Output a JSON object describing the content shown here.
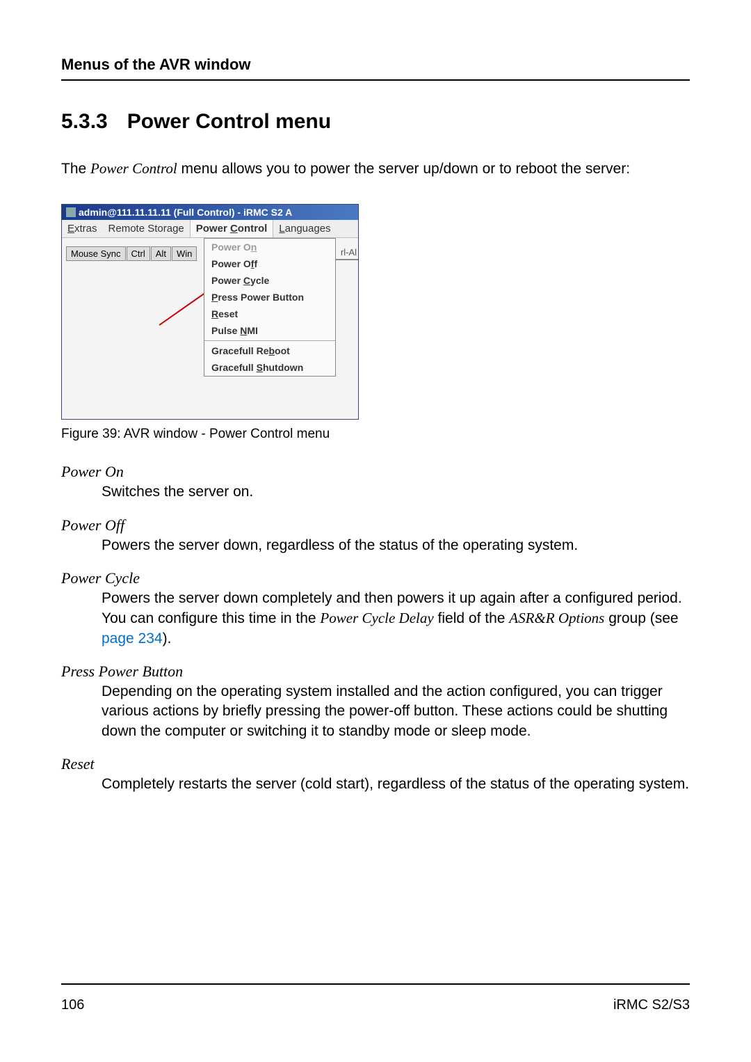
{
  "header": {
    "title": "Menus of the AVR window"
  },
  "section": {
    "num": "5.3.3",
    "title": "Power Control menu"
  },
  "intro": {
    "pre": "The ",
    "em": "Power Control",
    "post": " menu allows you to power the server up/down or to reboot the server:"
  },
  "avr": {
    "titlebar": "admin@111.11.11.11 (Full Control) - iRMC S2 A",
    "menus": {
      "extras": "Extras",
      "remote_storage": "Remote Storage",
      "power_control": "Power Control",
      "languages": "Languages"
    },
    "toolbar": {
      "mouse_sync": "Mouse Sync",
      "ctrl": "Ctrl",
      "alt": "Alt",
      "win": "Win"
    },
    "right_fragment": "rl-Al",
    "dropdown": {
      "power_on": "Power On",
      "power_off": "Power Off",
      "power_cycle": "Power Cycle",
      "press_power": "Press Power Button",
      "reset": "Reset",
      "pulse_nmi": "Pulse NMI",
      "graceful_reboot": "Gracefull Reboot",
      "graceful_shutdown": "Gracefull Shutdown"
    }
  },
  "figure_caption": "Figure 39: AVR window - Power Control menu",
  "defs": {
    "power_on": {
      "term": "Power On",
      "body": "Switches the server on."
    },
    "power_off": {
      "term": "Power Off",
      "body": "Powers the server down, regardless of the status of the operating system."
    },
    "power_cycle": {
      "term": "Power Cycle",
      "body1": "Powers the server down completely and then powers it up again after a configured period. You can configure this time in the ",
      "em1": "Power Cycle Delay",
      "body2": " field of the ",
      "em2": "ASR&R Options",
      "body3": " group (see ",
      "link": "page 234",
      "body4": ")."
    },
    "press_power": {
      "term": "Press Power Button",
      "body": "Depending on the operating system installed and the action configured, you can trigger various actions by briefly pressing the power-off button. These actions could be shutting down the computer or switching it to standby mode or sleep mode."
    },
    "reset": {
      "term": "Reset",
      "body": "Completely restarts the server (cold start), regardless of the status of the operating system."
    }
  },
  "footer": {
    "page": "106",
    "product": "iRMC S2/S3"
  }
}
